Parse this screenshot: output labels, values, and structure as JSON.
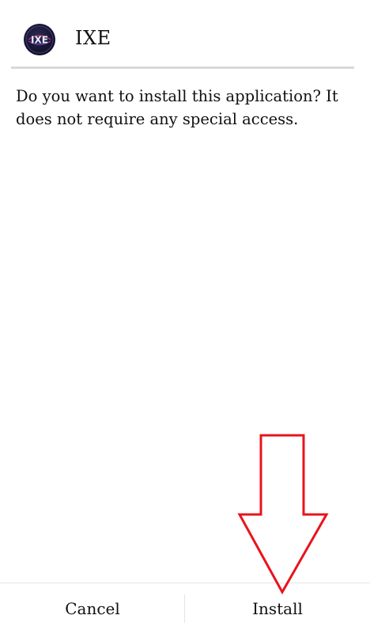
{
  "app": {
    "name": "IXE",
    "icon": "ixe-logo-icon",
    "icon_text": "IXE"
  },
  "dialog": {
    "message": "Do you want to install this application? It does not require any special access."
  },
  "buttons": {
    "cancel_label": "Cancel",
    "install_label": "Install"
  },
  "annotation": {
    "type": "down-arrow",
    "color": "#e8141c"
  }
}
